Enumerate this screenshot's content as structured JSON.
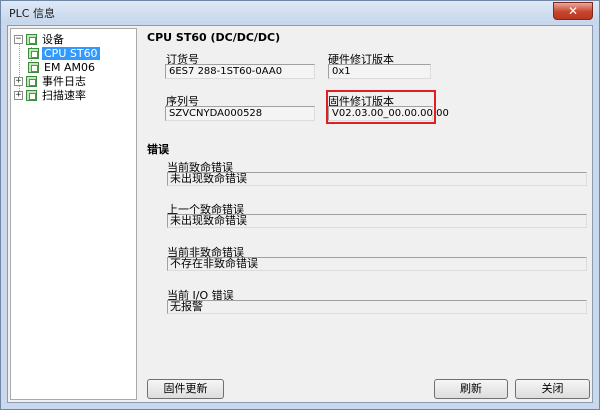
{
  "window": {
    "title": "PLC 信息",
    "close_symbol": "✕"
  },
  "tree": {
    "root_expander": "−",
    "items": [
      {
        "label": "设备",
        "expander": "−"
      },
      {
        "label": "CPU ST60",
        "selected": true
      },
      {
        "label": "EM AM06"
      },
      {
        "label": "事件日志",
        "expander": "+"
      },
      {
        "label": "扫描速率",
        "expander": "+"
      }
    ]
  },
  "device": {
    "heading": "CPU ST60 (DC/DC/DC)",
    "order_number": {
      "label": "订货号",
      "value": "6ES7 288-1ST60-0AA0"
    },
    "hardware_revision": {
      "label": "硬件修订版本",
      "value": "0x1"
    },
    "serial_number": {
      "label": "序列号",
      "value": "SZVCNYDA000528"
    },
    "firmware_revision": {
      "label": "固件修订版本",
      "value": "V02.03.00_00.00.00.00"
    }
  },
  "errors": {
    "title": "错误",
    "fatal_current": {
      "label": "当前致命错误",
      "value": "未出现致命错误"
    },
    "fatal_previous": {
      "label": "上一个致命错误",
      "value": "未出现致命错误"
    },
    "nonfatal_current": {
      "label": "当前非致命错误",
      "value": "不存在非致命错误"
    },
    "io_current": {
      "label": "当前 I/O 错误",
      "value": "无报警"
    }
  },
  "buttons": {
    "firmware_update": "固件更新",
    "refresh": "刷新",
    "close": "关闭"
  }
}
